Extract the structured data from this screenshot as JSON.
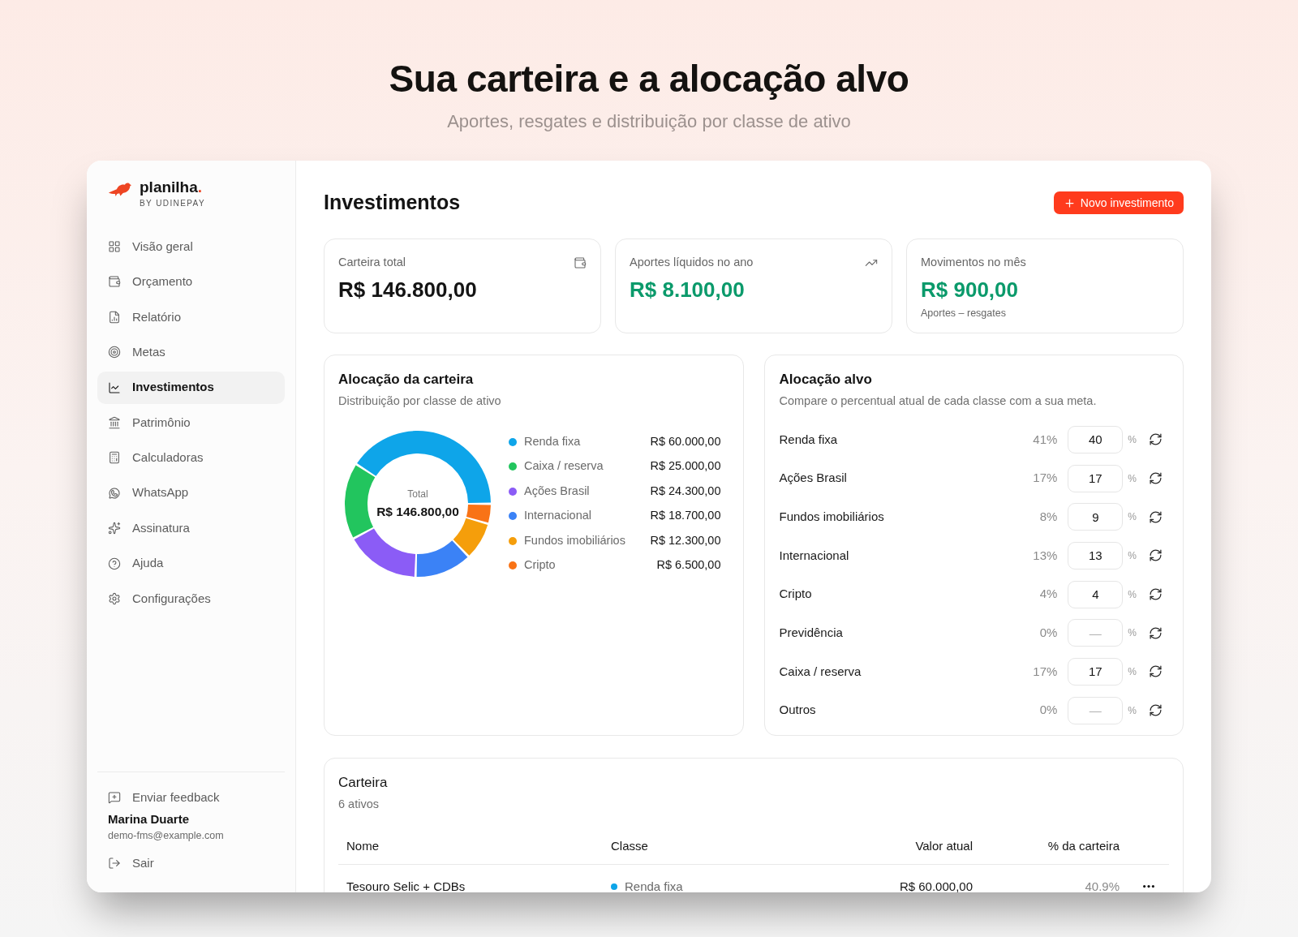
{
  "hero": {
    "title": "Sua carteira e a alocação alvo",
    "subtitle": "Aportes, resgates e distribuição por classe de ativo"
  },
  "sidebar": {
    "logo": {
      "name": "planilha",
      "dot": ".",
      "tagline": "BY UDINEPAY"
    },
    "items": [
      {
        "label": "Visão geral",
        "selected": false
      },
      {
        "label": "Orçamento",
        "selected": false
      },
      {
        "label": "Relatório",
        "selected": false
      },
      {
        "label": "Metas",
        "selected": false
      },
      {
        "label": "Investimentos",
        "selected": true
      },
      {
        "label": "Patrimônio",
        "selected": false
      },
      {
        "label": "Calculadoras",
        "selected": false
      },
      {
        "label": "WhatsApp",
        "selected": false
      },
      {
        "label": "Assinatura",
        "selected": false
      },
      {
        "label": "Ajuda",
        "selected": false
      },
      {
        "label": "Configurações",
        "selected": false
      }
    ],
    "feedback": "Enviar feedback",
    "user": {
      "name": "Marina Duarte",
      "email": "demo-fms@example.com"
    },
    "logout": "Sair"
  },
  "header": {
    "title": "Investimentos",
    "button": "Novo investimento"
  },
  "stats": [
    {
      "label": "Carteira total",
      "value": "R$ 146.800,00",
      "color": "#141414"
    },
    {
      "label": "Aportes líquidos no ano",
      "value": "R$ 8.100,00",
      "color": "#0b9a6b"
    },
    {
      "label": "Movimentos no mês",
      "value": "R$ 900,00",
      "color": "#0b9a6b",
      "note": "Aportes – resgates"
    }
  ],
  "portfolio_allocation": {
    "title": "Alocação da carteira",
    "subtitle": "Distribuição por classe de ativo",
    "center_label": "Total",
    "center_value": "R$ 146.800,00",
    "chart_data": {
      "type": "donut",
      "categories": [
        "Renda fixa",
        "Caixa / reserva",
        "Ações Brasil",
        "Internacional",
        "Fundos imobiliários",
        "Cripto"
      ],
      "values": [
        40.9,
        17.0,
        16.6,
        12.7,
        8.4,
        4.4
      ]
    },
    "legend": [
      {
        "amount": "R$ 60.000,00",
        "color": "#0ea5e9"
      },
      {
        "amount": "R$ 25.000,00",
        "color": "#22c55e"
      },
      {
        "amount": "R$ 24.300,00",
        "color": "#8b5cf6"
      },
      {
        "amount": "R$ 18.700,00",
        "color": "#3b82f6"
      },
      {
        "amount": "R$ 12.300,00",
        "color": "#f59e0b"
      },
      {
        "amount": "R$ 6.500,00",
        "color": "#f97316"
      }
    ]
  },
  "target_allocation": {
    "title": "Alocação alvo",
    "subtitle": "Compare o percentual atual de cada classe com a sua meta.",
    "rows": [
      {
        "label": "Renda fixa",
        "current": "41%",
        "target": "40",
        "unit": "%"
      },
      {
        "label": "Ações Brasil",
        "current": "17%",
        "target": "17",
        "unit": "%"
      },
      {
        "label": "Fundos imobiliários",
        "current": "8%",
        "target": "9",
        "unit": "%"
      },
      {
        "label": "Internacional",
        "current": "13%",
        "target": "13",
        "unit": "%"
      },
      {
        "label": "Cripto",
        "current": "4%",
        "target": "4",
        "unit": "%"
      },
      {
        "label": "Previdência",
        "current": "0%",
        "placeholder": "—",
        "unit": "%"
      },
      {
        "label": "Caixa / reserva",
        "current": "17%",
        "target": "17",
        "unit": "%"
      },
      {
        "label": "Outros",
        "current": "0%",
        "placeholder": "—",
        "unit": "%"
      }
    ]
  },
  "holdings": {
    "title": "Carteira",
    "count": "6 ativos",
    "columns": [
      "Nome",
      "Classe",
      "Valor atual",
      "% da carteira"
    ],
    "rows": [
      {
        "name": "Tesouro Selic + CDBs",
        "class": "Renda fixa",
        "color": "#0ea5e9",
        "value": "R$ 60.000,00",
        "share": "40.9%"
      }
    ]
  }
}
